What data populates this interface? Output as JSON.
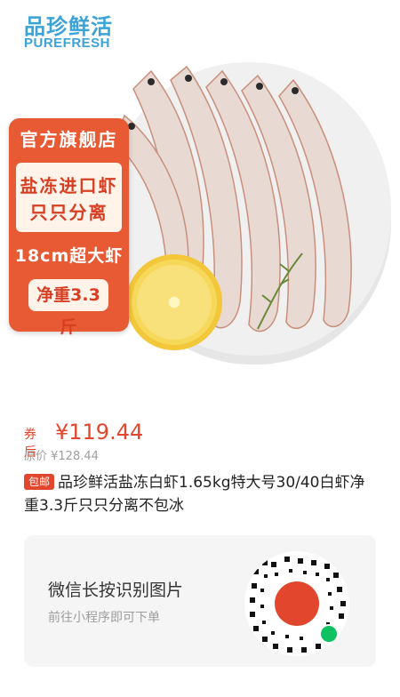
{
  "brand": {
    "name_cn": "品珍鲜活",
    "name_en": "PUREFRESH"
  },
  "badge": {
    "top": "官方旗舰店",
    "line1": "盐冻进口虾",
    "line2": "只只分离",
    "size": "18cm超大虾",
    "weight": "净重3.3斤"
  },
  "price": {
    "label": "券后",
    "value": "¥119.44",
    "original": "原价 ¥128.44"
  },
  "title": {
    "tag": "包邮",
    "text": "品珍鲜活盐冻白虾1.65kg特大号30/40白虾净重3.3斤只只分离不包冰"
  },
  "card": {
    "title": "微信长按识别图片",
    "subtitle": "前往小程序即可下单",
    "qr_icon": "qr-code-icon",
    "app_icon": "pinduoduo-logo-icon",
    "wechat_icon": "wechat-mini-program-icon"
  },
  "colors": {
    "accent": "#e2472d",
    "brand": "#3aa3d8",
    "badge": "#e85a33"
  }
}
